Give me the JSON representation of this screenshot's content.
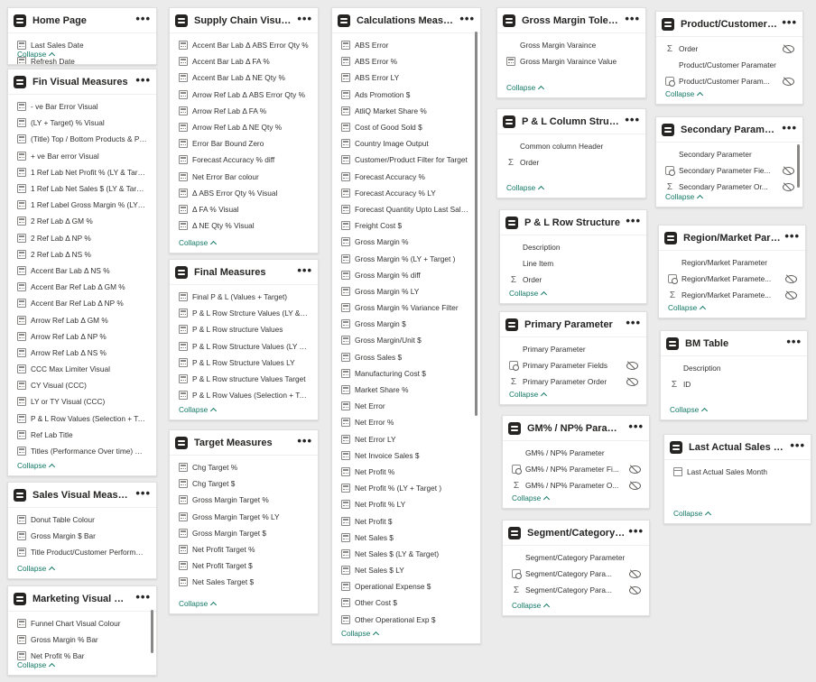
{
  "more_glyph": "•••",
  "collapse_label": "Collapse",
  "cards": {
    "home_page": {
      "title": "Home Page",
      "items": [
        {
          "label": "Last Sales Date",
          "icon": "calc"
        },
        {
          "label": "Refresh Date",
          "icon": "calc"
        }
      ]
    },
    "fin_visual": {
      "title": "Fin Visual Measures",
      "items": [
        {
          "label": "- ve Bar Error Visual",
          "icon": "calc"
        },
        {
          "label": "(LY + Target) % Visual",
          "icon": "calc"
        },
        {
          "label": "(Title) Top / Bottom Products & Pr...",
          "icon": "calc"
        },
        {
          "label": "+ ve Bar error Visual",
          "icon": "calc"
        },
        {
          "label": "1 Ref Lab Net Profit % (LY & Target)",
          "icon": "calc"
        },
        {
          "label": "1 Ref Lab Net Sales $ (LY & Target)",
          "icon": "calc"
        },
        {
          "label": "1 Ref Label Gross Margin % (LY + ...",
          "icon": "calc"
        },
        {
          "label": "2 Ref Lab Δ GM %",
          "icon": "calc"
        },
        {
          "label": "2 Ref Lab Δ NP %",
          "icon": "calc"
        },
        {
          "label": "2 Ref Lab Δ NS %",
          "icon": "calc"
        },
        {
          "label": "Accent Bar Lab Δ NS %",
          "icon": "calc"
        },
        {
          "label": "Accent Bar Ref Lab Δ GM %",
          "icon": "calc"
        },
        {
          "label": "Accent Bar Ref Lab Δ NP %",
          "icon": "calc"
        },
        {
          "label": "Arrow Ref Lab Δ GM %",
          "icon": "calc"
        },
        {
          "label": "Arrow Ref Lab Δ NP %",
          "icon": "calc"
        },
        {
          "label": "Arrow Ref Lab Δ NS %",
          "icon": "calc"
        },
        {
          "label": "CCC Max Limiter Visual",
          "icon": "calc"
        },
        {
          "label": "CY Visual (CCC)",
          "icon": "calc"
        },
        {
          "label": "LY or TY Visual (CCC)",
          "icon": "calc"
        },
        {
          "label": "P & L Row Values (Selection + Tar...",
          "icon": "calc"
        },
        {
          "label": "Ref Lab Title",
          "icon": "calc"
        },
        {
          "label": "Titles (Performance Over time) CCC",
          "icon": "calc"
        }
      ]
    },
    "sales_visual": {
      "title": "Sales Visual Measures",
      "items": [
        {
          "label": "Donut Table Colour",
          "icon": "calc"
        },
        {
          "label": "Gross Margin $ Bar",
          "icon": "calc"
        },
        {
          "label": "Title Product/Customer Performan...",
          "icon": "calc"
        }
      ]
    },
    "marketing_visual": {
      "title": "Marketing Visual Meas...",
      "items": [
        {
          "label": "Funnel Chart Visual Colour",
          "icon": "calc"
        },
        {
          "label": "Gross Margin % Bar",
          "icon": "calc"
        },
        {
          "label": "Net Profit % Bar",
          "icon": "calc"
        }
      ]
    },
    "supply_chain": {
      "title": "Supply Chain Visual Me...",
      "items": [
        {
          "label": "Accent Bar Lab Δ ABS Error Qty %",
          "icon": "calc"
        },
        {
          "label": "Accent Bar Lab Δ FA %",
          "icon": "calc"
        },
        {
          "label": "Accent Bar Lab Δ NE Qty %",
          "icon": "calc"
        },
        {
          "label": "Arrow Ref Lab Δ ABS Error Qty %",
          "icon": "calc"
        },
        {
          "label": "Arrow Ref Lab Δ FA %",
          "icon": "calc"
        },
        {
          "label": "Arrow Ref Lab Δ NE Qty %",
          "icon": "calc"
        },
        {
          "label": "Error Bar Bound Zero",
          "icon": "calc"
        },
        {
          "label": "Forecast Accuracy % diff",
          "icon": "calc"
        },
        {
          "label": "Net Error Bar colour",
          "icon": "calc"
        },
        {
          "label": "Δ ABS Error Qty % Visual",
          "icon": "calc"
        },
        {
          "label": "Δ FA % Visual",
          "icon": "calc"
        },
        {
          "label": "Δ NE Qty % Visual",
          "icon": "calc"
        }
      ]
    },
    "final_measures": {
      "title": "Final Measures",
      "items": [
        {
          "label": "Final P & L (Values + Target)",
          "icon": "calc"
        },
        {
          "label": "P & L Row Strcture Values (LY & Ta...",
          "icon": "calc"
        },
        {
          "label": "P & L Row structure Values",
          "icon": "calc"
        },
        {
          "label": "P & L Row Structure Values (LY & T...",
          "icon": "calc"
        },
        {
          "label": "P & L Row Structure Values LY",
          "icon": "calc"
        },
        {
          "label": "P & L Row structure Values Target",
          "icon": "calc"
        },
        {
          "label": "P & L Row Values (Selection + Tar...",
          "icon": "calc"
        }
      ]
    },
    "target_measures": {
      "title": "Target Measures",
      "items": [
        {
          "label": "Chg Target %",
          "icon": "calc"
        },
        {
          "label": "Chg Target $",
          "icon": "calc"
        },
        {
          "label": "Gross Margin Target %",
          "icon": "calc"
        },
        {
          "label": "Gross Margin Target % LY",
          "icon": "calc"
        },
        {
          "label": "Gross Margin Target $",
          "icon": "calc"
        },
        {
          "label": "Net Profit Target %",
          "icon": "calc"
        },
        {
          "label": "Net Profit Target $",
          "icon": "calc"
        },
        {
          "label": "Net Sales Target $",
          "icon": "calc"
        }
      ]
    },
    "calculations": {
      "title": "Calculations Measures",
      "items": [
        {
          "label": "ABS Error",
          "icon": "calc"
        },
        {
          "label": "ABS Error %",
          "icon": "calc"
        },
        {
          "label": "ABS Error LY",
          "icon": "calc"
        },
        {
          "label": "Ads Promotion $",
          "icon": "calc"
        },
        {
          "label": "AtliQ Market Share %",
          "icon": "calc"
        },
        {
          "label": "Cost of Good Sold $",
          "icon": "calc"
        },
        {
          "label": "Country Image Output",
          "icon": "calc"
        },
        {
          "label": "Customer/Product Filter for Target",
          "icon": "calc"
        },
        {
          "label": "Forecast Accuracy %",
          "icon": "calc"
        },
        {
          "label": "Forecast Accuracy % LY",
          "icon": "calc"
        },
        {
          "label": "Forecast Quantity Upto Last Sales...",
          "icon": "calc"
        },
        {
          "label": "Freight Cost $",
          "icon": "calc"
        },
        {
          "label": "Gross Margin %",
          "icon": "calc"
        },
        {
          "label": "Gross Margin % (LY + Target )",
          "icon": "calc"
        },
        {
          "label": "Gross Margin % diff",
          "icon": "calc"
        },
        {
          "label": "Gross Margin % LY",
          "icon": "calc"
        },
        {
          "label": "Gross Margin % Variance Filter",
          "icon": "calc"
        },
        {
          "label": "Gross Margin $",
          "icon": "calc"
        },
        {
          "label": "Gross Margin/Unit $",
          "icon": "calc"
        },
        {
          "label": "Gross Sales $",
          "icon": "calc"
        },
        {
          "label": "Manufacturing Cost $",
          "icon": "calc"
        },
        {
          "label": "Market Share %",
          "icon": "calc"
        },
        {
          "label": "Net Error",
          "icon": "calc"
        },
        {
          "label": "Net Error %",
          "icon": "calc"
        },
        {
          "label": "Net Error LY",
          "icon": "calc"
        },
        {
          "label": "Net Invoice Sales $",
          "icon": "calc"
        },
        {
          "label": "Net Profit %",
          "icon": "calc"
        },
        {
          "label": "Net Profit % (LY + Target )",
          "icon": "calc"
        },
        {
          "label": "Net Profit % LY",
          "icon": "calc"
        },
        {
          "label": "Net Profit $",
          "icon": "calc"
        },
        {
          "label": "Net Sales $",
          "icon": "calc"
        },
        {
          "label": "Net Sales $ (LY & Target)",
          "icon": "calc"
        },
        {
          "label": "Net Sales $ LY",
          "icon": "calc"
        },
        {
          "label": "Operational Expense $",
          "icon": "calc"
        },
        {
          "label": "Other Cost $",
          "icon": "calc"
        },
        {
          "label": "Other Operational Exp $",
          "icon": "calc"
        }
      ]
    },
    "gm_tolerance": {
      "title": "Gross Margin Tolerance",
      "items": [
        {
          "label": "Gross Margin Varaince",
          "icon": "blank"
        },
        {
          "label": "Gross Margin Varaince Value",
          "icon": "calc"
        }
      ]
    },
    "pl_column": {
      "title": "P & L Column Structure ...",
      "items": [
        {
          "label": "Common column Header",
          "icon": "blank"
        },
        {
          "label": "Order",
          "icon": "sum"
        }
      ]
    },
    "pl_row": {
      "title": "P & L Row Structure",
      "items": [
        {
          "label": "Description",
          "icon": "blank"
        },
        {
          "label": "Line Item",
          "icon": "blank"
        },
        {
          "label": "Order",
          "icon": "sum"
        }
      ]
    },
    "primary_param": {
      "title": "Primary Parameter",
      "items": [
        {
          "label": "Primary Parameter",
          "icon": "blank",
          "hidden": false
        },
        {
          "label": "Primary Parameter Fields",
          "icon": "param",
          "hidden": true
        },
        {
          "label": "Primary Parameter Order",
          "icon": "sum",
          "hidden": true
        }
      ]
    },
    "gm_np_param": {
      "title": "GM% / NP% Parameter",
      "items": [
        {
          "label": "GM% / NP% Parameter",
          "icon": "blank",
          "hidden": false
        },
        {
          "label": "GM% / NP% Parameter Fi...",
          "icon": "param",
          "hidden": true
        },
        {
          "label": "GM% / NP% Parameter O...",
          "icon": "sum",
          "hidden": true
        }
      ]
    },
    "segment_param": {
      "title": "Segment/Category Para...",
      "items": [
        {
          "label": "Segment/Category Parameter",
          "icon": "blank",
          "hidden": false
        },
        {
          "label": "Segment/Category Para...",
          "icon": "param",
          "hidden": true
        },
        {
          "label": "Segment/Category Para...",
          "icon": "sum",
          "hidden": true
        }
      ]
    },
    "product_customer_param": {
      "title": "Product/Customer Para...",
      "items": [
        {
          "label": "Order",
          "icon": "sum",
          "hidden": true
        },
        {
          "label": "Product/Customer Paramater",
          "icon": "blank",
          "hidden": false
        },
        {
          "label": "Product/Customer Param...",
          "icon": "param",
          "hidden": true
        }
      ]
    },
    "secondary_param": {
      "title": "Secondary Parameter",
      "items": [
        {
          "label": "Secondary Parameter",
          "icon": "blank",
          "hidden": false
        },
        {
          "label": "Secondary Parameter Fie...",
          "icon": "param",
          "hidden": true
        },
        {
          "label": "Secondary Parameter Or...",
          "icon": "sum",
          "hidden": true
        }
      ]
    },
    "region_param": {
      "title": "Region/Market Paramet...",
      "items": [
        {
          "label": "Region/Market Parameter",
          "icon": "blank",
          "hidden": false
        },
        {
          "label": "Region/Market Paramete...",
          "icon": "param",
          "hidden": true
        },
        {
          "label": "Region/Market Paramete...",
          "icon": "sum",
          "hidden": true
        }
      ]
    },
    "bm_table": {
      "title": "BM Table",
      "items": [
        {
          "label": "Description",
          "icon": "blank"
        },
        {
          "label": "ID",
          "icon": "sum"
        }
      ]
    },
    "last_actual": {
      "title": "Last Actual Sales Month",
      "items": [
        {
          "label": "Last Actual Sales Month",
          "icon": "col"
        }
      ]
    }
  }
}
